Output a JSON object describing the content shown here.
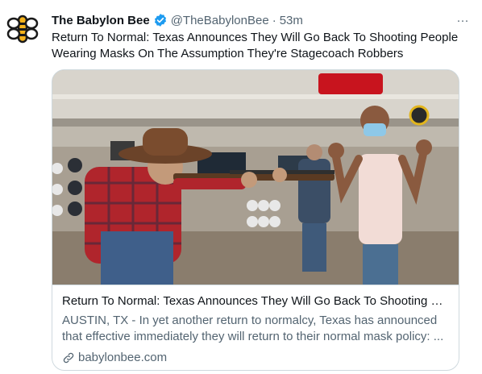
{
  "tweet": {
    "account_name": "The Babylon Bee",
    "handle": "@TheBabylonBee",
    "separator": "·",
    "time": "53m",
    "more_label": "···",
    "text": "Return To Normal: Texas Announces They Will Go Back To Shooting People Wearing Masks On The Assumption They're Stagecoach Robbers",
    "verified_icon": "verified-badge-icon",
    "verified_color": "#1d9bf0",
    "brand_color": "#1a1a1a",
    "brand_accent": "#f5b21a"
  },
  "card": {
    "image_description_icon": "article-image",
    "title": "Return To Normal: Texas Announces They Will Go Back To Shooting Pe...",
    "description": "AUSTIN, TX - In yet another return to normalcy, Texas has announced that effective immediately they will return to their normal mask policy: ...",
    "domain": "babylonbee.com",
    "link_icon": "link-icon"
  }
}
